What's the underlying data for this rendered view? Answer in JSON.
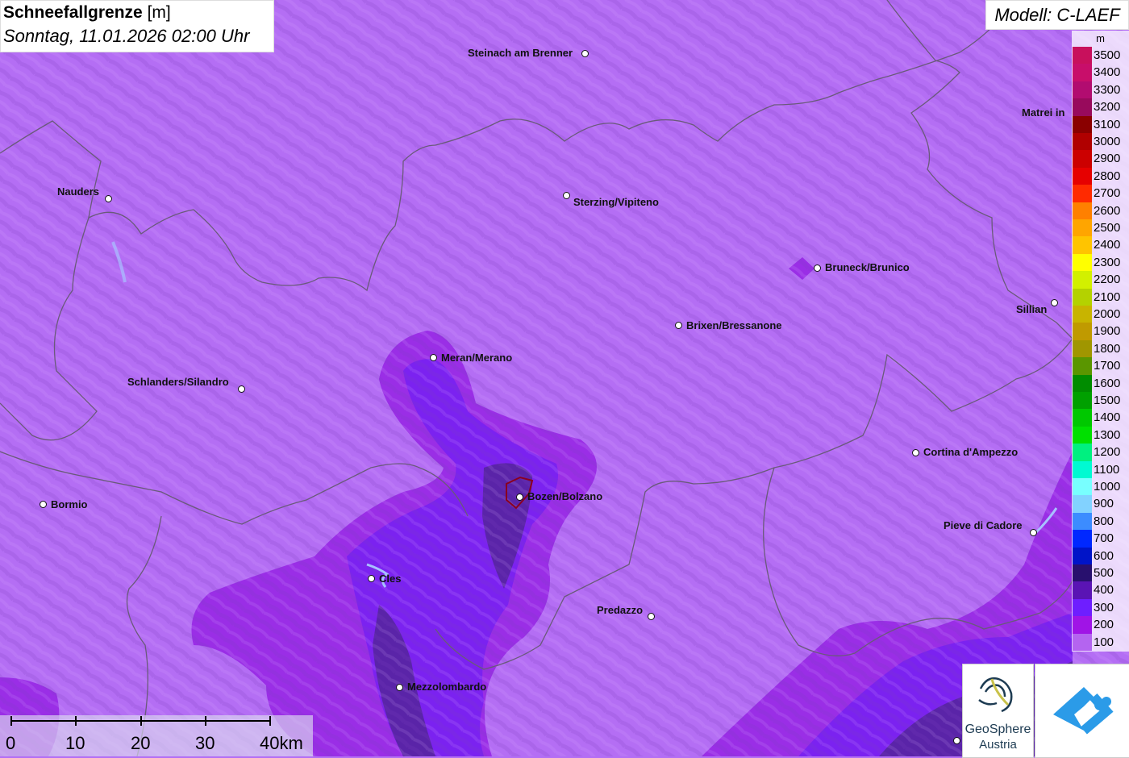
{
  "header": {
    "title_bold": "Schneefallgrenze",
    "title_unit": "[m]",
    "datetime": "Sonntag, 11.01.2026 02:00 Uhr"
  },
  "model": "Modell: C-LAEF",
  "legend": {
    "unit": "m",
    "items": [
      {
        "value": "3500",
        "color": "#c8105c"
      },
      {
        "value": "3400",
        "color": "#c80e6a"
      },
      {
        "value": "3300",
        "color": "#b20c70"
      },
      {
        "value": "3200",
        "color": "#980a5c"
      },
      {
        "value": "3100",
        "color": "#8a0000"
      },
      {
        "value": "3000",
        "color": "#b00000"
      },
      {
        "value": "2900",
        "color": "#cc0000"
      },
      {
        "value": "2800",
        "color": "#e60000"
      },
      {
        "value": "2700",
        "color": "#ff2a00"
      },
      {
        "value": "2600",
        "color": "#ff8000"
      },
      {
        "value": "2500",
        "color": "#ffa500"
      },
      {
        "value": "2400",
        "color": "#ffc400"
      },
      {
        "value": "2300",
        "color": "#ffff00"
      },
      {
        "value": "2200",
        "color": "#d2f000"
      },
      {
        "value": "2100",
        "color": "#b4d200"
      },
      {
        "value": "2000",
        "color": "#c8b400"
      },
      {
        "value": "1900",
        "color": "#c09a00"
      },
      {
        "value": "1800",
        "color": "#a09600"
      },
      {
        "value": "1700",
        "color": "#5a9600"
      },
      {
        "value": "1600",
        "color": "#008c00"
      },
      {
        "value": "1500",
        "color": "#00a000"
      },
      {
        "value": "1400",
        "color": "#00c800"
      },
      {
        "value": "1300",
        "color": "#00e000"
      },
      {
        "value": "1200",
        "color": "#00f080"
      },
      {
        "value": "1100",
        "color": "#00fad2"
      },
      {
        "value": "1000",
        "color": "#78ffff"
      },
      {
        "value": "900",
        "color": "#82d2ff"
      },
      {
        "value": "800",
        "color": "#3c8cff"
      },
      {
        "value": "700",
        "color": "#0028ff"
      },
      {
        "value": "600",
        "color": "#0014c8"
      },
      {
        "value": "500",
        "color": "#28106e"
      },
      {
        "value": "400",
        "color": "#5a14b4"
      },
      {
        "value": "300",
        "color": "#6e1eff"
      },
      {
        "value": "200",
        "color": "#a014e6"
      },
      {
        "value": "100",
        "color": "#b464f0"
      }
    ]
  },
  "cities": [
    {
      "name": "Steinach am Brenner"
    },
    {
      "name": "Matrei in"
    },
    {
      "name": "Nauders"
    },
    {
      "name": "Sterzing/Vipiteno"
    },
    {
      "name": "Bruneck/Brunico"
    },
    {
      "name": "Sillian"
    },
    {
      "name": "Brixen/Bressanone"
    },
    {
      "name": "Meran/Merano"
    },
    {
      "name": "Schlanders/Silandro"
    },
    {
      "name": "Cortina d'Ampezzo"
    },
    {
      "name": "Bormio"
    },
    {
      "name": "Bozen/Bolzano"
    },
    {
      "name": "Pieve di Cadore"
    },
    {
      "name": "Cles"
    },
    {
      "name": "Predazzo"
    },
    {
      "name": "Mezzolombardo"
    }
  ],
  "scale": {
    "labels": [
      "0",
      "10",
      "20",
      "30",
      "40km"
    ]
  },
  "logos": {
    "geosphere_line1": "GeoSphere",
    "geosphere_line2": "Austria"
  }
}
